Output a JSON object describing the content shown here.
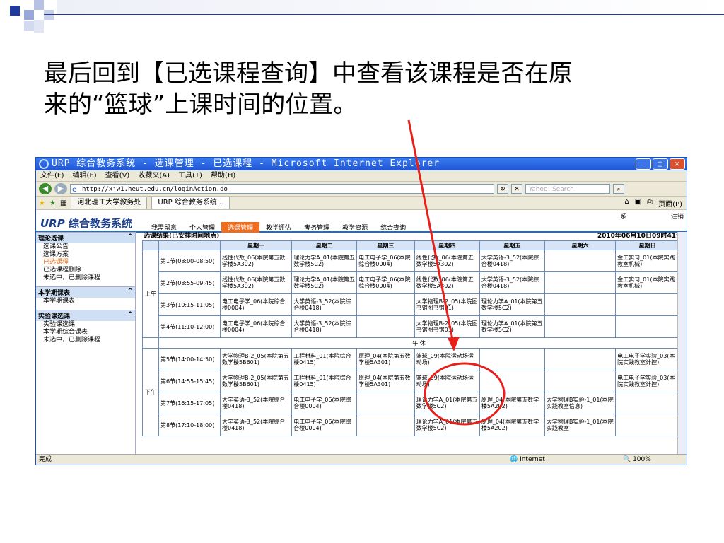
{
  "slide": {
    "title_line1": "最后回到【已选课程查询】中查看该课程是否在原",
    "title_line2": "来的“篮球”上课时间的位置。",
    "accent_color": "#1f3a9b",
    "annotation_color": "#e8201a"
  },
  "window": {
    "title": "URP 综合教务系统 - 选课管理 - 已选课程 - Microsoft Internet Explorer",
    "min_icon": "minimize-icon",
    "max_icon": "maximize-icon",
    "close_icon": "close-icon"
  },
  "menu": [
    "文件(F)",
    "编辑(E)",
    "查看(V)",
    "收藏夹(A)",
    "工具(T)",
    "帮助(H)"
  ],
  "address": {
    "url": "http://xjw1.heut.edu.cn/loginAction.do",
    "search_placeholder": "Yahoo! Search"
  },
  "favorites": {
    "tabs": [
      "河北理工大学教务处",
      "URP 综合教务系统..."
    ],
    "page_menu": "页面(P)"
  },
  "app": {
    "logo_a": "URP",
    "logo_b": "综合教务系统",
    "nav": [
      "我需留意",
      "个人管理",
      "选课管理",
      "教学评估",
      "考务管理",
      "教学资源",
      "综合查询"
    ],
    "active_nav": "选课管理",
    "logout": "注销",
    "right_char": "系"
  },
  "sidebar": [
    {
      "head": "理论选课",
      "items": [
        "选课公告",
        "选课方案",
        "已选课程",
        "已选课程删除",
        "未选中，已删除课程"
      ]
    },
    {
      "head": "本学期课表",
      "items": [
        "本学期课表"
      ]
    },
    {
      "head": "实验课选课",
      "items": [
        "实验课选课",
        "本学期综合课表",
        "未选中，已删除课程"
      ]
    }
  ],
  "content": {
    "header_left": "选课结果(已安排时间地点)",
    "header_right": "2010年06月10日09时41分",
    "days": [
      "星期一",
      "星期二",
      "星期三",
      "星期四",
      "星期五",
      "星期六",
      "星期日"
    ],
    "am_label": "上午",
    "pm_label": "下午",
    "noon_label": "午 休",
    "am_rows": [
      {
        "period": "第1节(08:00-08:50)",
        "cells": [
          "线性代数_06(本院第五数学楼5A302)",
          "理论力学A_01(本院第五数学楼5C2)",
          "电工电子学_06(本院综合楼0004)",
          "线性代数_06(本院第五数学楼5A302)",
          "大学英语-3_52(本院综合楼0418)",
          "",
          "金工实习_01(本院实践教室机械)"
        ]
      },
      {
        "period": "第2节(08:55-09:45)",
        "cells": [
          "线性代数_06(本院第五数学楼5A302)",
          "理论力学A_01(本院第五数学楼5C2)",
          "电工电子学_06(本院综合楼0004)",
          "线性代数_06(本院第五数学楼5A302)",
          "大学英语-3_52(本院综合楼0418)",
          "",
          "金工实习_01(本院实践教室机械)"
        ]
      },
      {
        "period": "第3节(10:15-11:05)",
        "cells": [
          "电工电子学_06(本院综合楼0004)",
          "大学英语-3_52(本院综合楼0418)",
          "",
          "大学物理B-2_05(本院图书馆图书馆01)",
          "理论力学A_01(本院第五数学楼5C2)",
          "",
          ""
        ]
      },
      {
        "period": "第4节(11:10-12:00)",
        "cells": [
          "电工电子学_06(本院综合楼0004)",
          "大学英语-3_52(本院综合楼0418)",
          "",
          "大学物理B-2_05(本院图书馆图书馆01)",
          "理论力学A_01(本院第五数学楼5C2)",
          "",
          ""
        ]
      }
    ],
    "pm_rows": [
      {
        "period": "第5节(14:00-14:50)",
        "cells": [
          "大学物理B-2_05(本院第五数学楼5B601)",
          "工程材料_01(本院综合楼0415)",
          "原理_04(本院第五数学楼5A301)",
          "篮球_09(本院运动场运动场)",
          "",
          "",
          "电工电子学实验_03(本院实践教室计控)"
        ]
      },
      {
        "period": "第6节(14:55-15:45)",
        "cells": [
          "大学物理B-2_05(本院第五数学楼5B601)",
          "工程材料_01(本院综合楼0415)",
          "原理_04(本院第五数学楼5A301)",
          "篮球_09(本院运动场运动场)",
          "",
          "",
          "电工电子学实验_03(本院实践教室计控)"
        ]
      },
      {
        "period": "第7节(16:15-17:05)",
        "cells": [
          "大学英语-3_52(本院综合楼0418)",
          "电工电子学_06(本院综合楼0004)",
          "",
          "理论力学A_01(本院第五数学楼5C2)",
          "原理_04(本院第五数学楼5A202)",
          "大学物理B实验-1_01(本院实践教室信息)",
          ""
        ]
      },
      {
        "period": "第8节(17:10-18:00)",
        "cells": [
          "大学英语-3_52(本院综合楼0418)",
          "电工电子学_06(本院综合楼0004)",
          "",
          "理论力学A_01(本院第五数学楼5C2)",
          "原理_04(本院第五数学楼5A202)",
          "大学物理B实验-1_01(本院实践教室",
          ""
        ]
      }
    ]
  },
  "status": {
    "done": "完成",
    "zone": "Internet",
    "zoom": "100%"
  }
}
